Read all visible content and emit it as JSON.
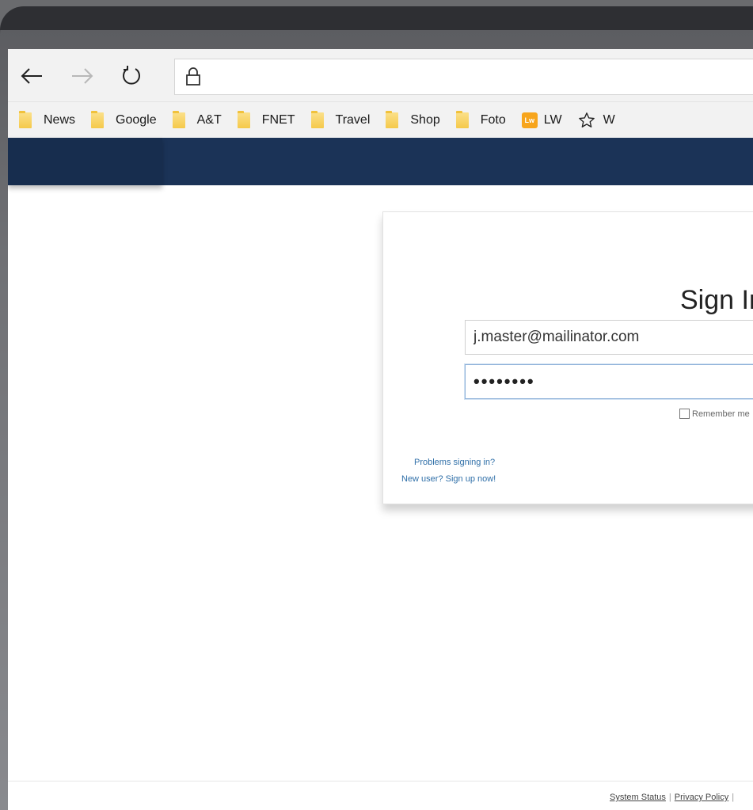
{
  "browser": {
    "nav": {
      "back_icon": "back-arrow-icon",
      "forward_icon": "forward-arrow-icon",
      "refresh_icon": "refresh-icon",
      "lock_icon": "lock-icon"
    },
    "bookmarks": [
      {
        "label": "News",
        "icon": "folder-icon"
      },
      {
        "label": "Google",
        "icon": "folder-icon"
      },
      {
        "label": "A&T",
        "icon": "folder-icon"
      },
      {
        "label": "FNET",
        "icon": "folder-icon"
      },
      {
        "label": "Travel",
        "icon": "folder-icon"
      },
      {
        "label": "Shop",
        "icon": "folder-icon"
      },
      {
        "label": "Foto",
        "icon": "folder-icon"
      },
      {
        "label": "LW",
        "icon": "lw-icon",
        "icon_text": "Lw"
      },
      {
        "label": "W",
        "icon": "star-icon"
      }
    ]
  },
  "colors": {
    "header": "#1b3357",
    "link": "#2f6fa8",
    "folder": "#f5c94a",
    "lw_icon": "#f7a51c"
  },
  "signin": {
    "title": "Sign In",
    "email_value": "j.master@mailinator.com",
    "password_value": "••••••••",
    "remember_label": "Remember me",
    "problems_link": "Problems signing in?",
    "new_user_link": "New user? Sign up now!"
  },
  "footer": {
    "system_status": "System Status",
    "separator": "|",
    "privacy_policy": "Privacy Policy"
  }
}
